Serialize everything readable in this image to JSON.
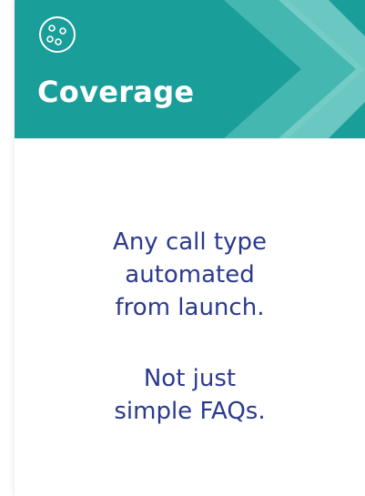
{
  "card": {
    "icon": "dots-circle-icon",
    "title": "Coverage",
    "line1": [
      "Any call type",
      "automated",
      "from launch."
    ],
    "line2": [
      "Not just",
      "simple FAQs."
    ]
  },
  "colors": {
    "header_teal": "#1a9e9a",
    "chevron_light": "#7fd1cc",
    "chevron_mid": "#4cbbb5",
    "text_navy": "#2b3a8c"
  }
}
